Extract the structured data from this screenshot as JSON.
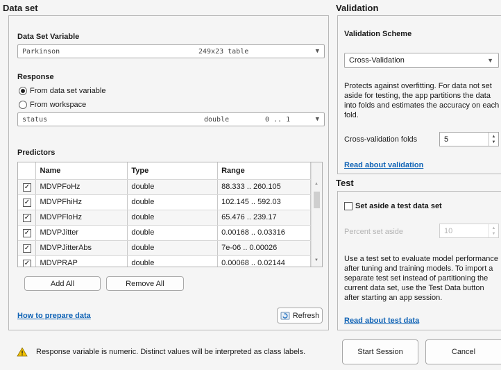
{
  "dataset": {
    "title": "Data set",
    "variable_label": "Data Set Variable",
    "variable_name": "Parkinson",
    "variable_size": "249x23 table",
    "response_label": "Response",
    "radio_from_dataset": "From data set variable",
    "radio_from_workspace": "From workspace",
    "response_name": "status",
    "response_type": "double",
    "response_range": "0 .. 1",
    "predictors_label": "Predictors",
    "columns": [
      "Name",
      "Type",
      "Range"
    ],
    "rows": [
      {
        "name": "MDVPFoHz",
        "type": "double",
        "range": "88.333 .. 260.105"
      },
      {
        "name": "MDVPFhiHz",
        "type": "double",
        "range": "102.145 .. 592.03"
      },
      {
        "name": "MDVPFloHz",
        "type": "double",
        "range": "65.476 .. 239.17"
      },
      {
        "name": "MDVPJitter",
        "type": "double",
        "range": "0.00168 .. 0.03316"
      },
      {
        "name": "MDVPJitterAbs",
        "type": "double",
        "range": "7e-06 .. 0.00026"
      },
      {
        "name": "MDVPRAP",
        "type": "double",
        "range": "0.00068 .. 0.02144"
      }
    ],
    "add_all": "Add All",
    "remove_all": "Remove All",
    "how_to_link": "How to prepare data",
    "refresh": "Refresh"
  },
  "validation": {
    "title": "Validation",
    "scheme_label": "Validation Scheme",
    "scheme_value": "Cross-Validation",
    "description": "Protects against overfitting. For data not set aside for testing, the app partitions the data into folds and estimates the accuracy on each fold.",
    "folds_label": "Cross-validation folds",
    "folds_value": "5",
    "read_link": "Read about validation"
  },
  "test": {
    "title": "Test",
    "checkbox_label": "Set aside a test data set",
    "percent_label": "Percent set aside",
    "percent_value": "10",
    "description": "Use a test set to evaluate model performance after tuning and training models. To import a separate test set instead of partitioning the current data set, use the Test Data button after starting an app session.",
    "read_link": "Read about test data"
  },
  "footer": {
    "warning": "Response variable is numeric. Distinct values will be interpreted as class labels.",
    "start": "Start Session",
    "cancel": "Cancel"
  },
  "icons": {
    "warning": "warning-triangle-icon",
    "refresh": "refresh-icon",
    "check": "checkmark-icon",
    "caret": "chevron-down-icon"
  },
  "colors": {
    "link": "#0e62b5",
    "warning": "#f2c200"
  }
}
